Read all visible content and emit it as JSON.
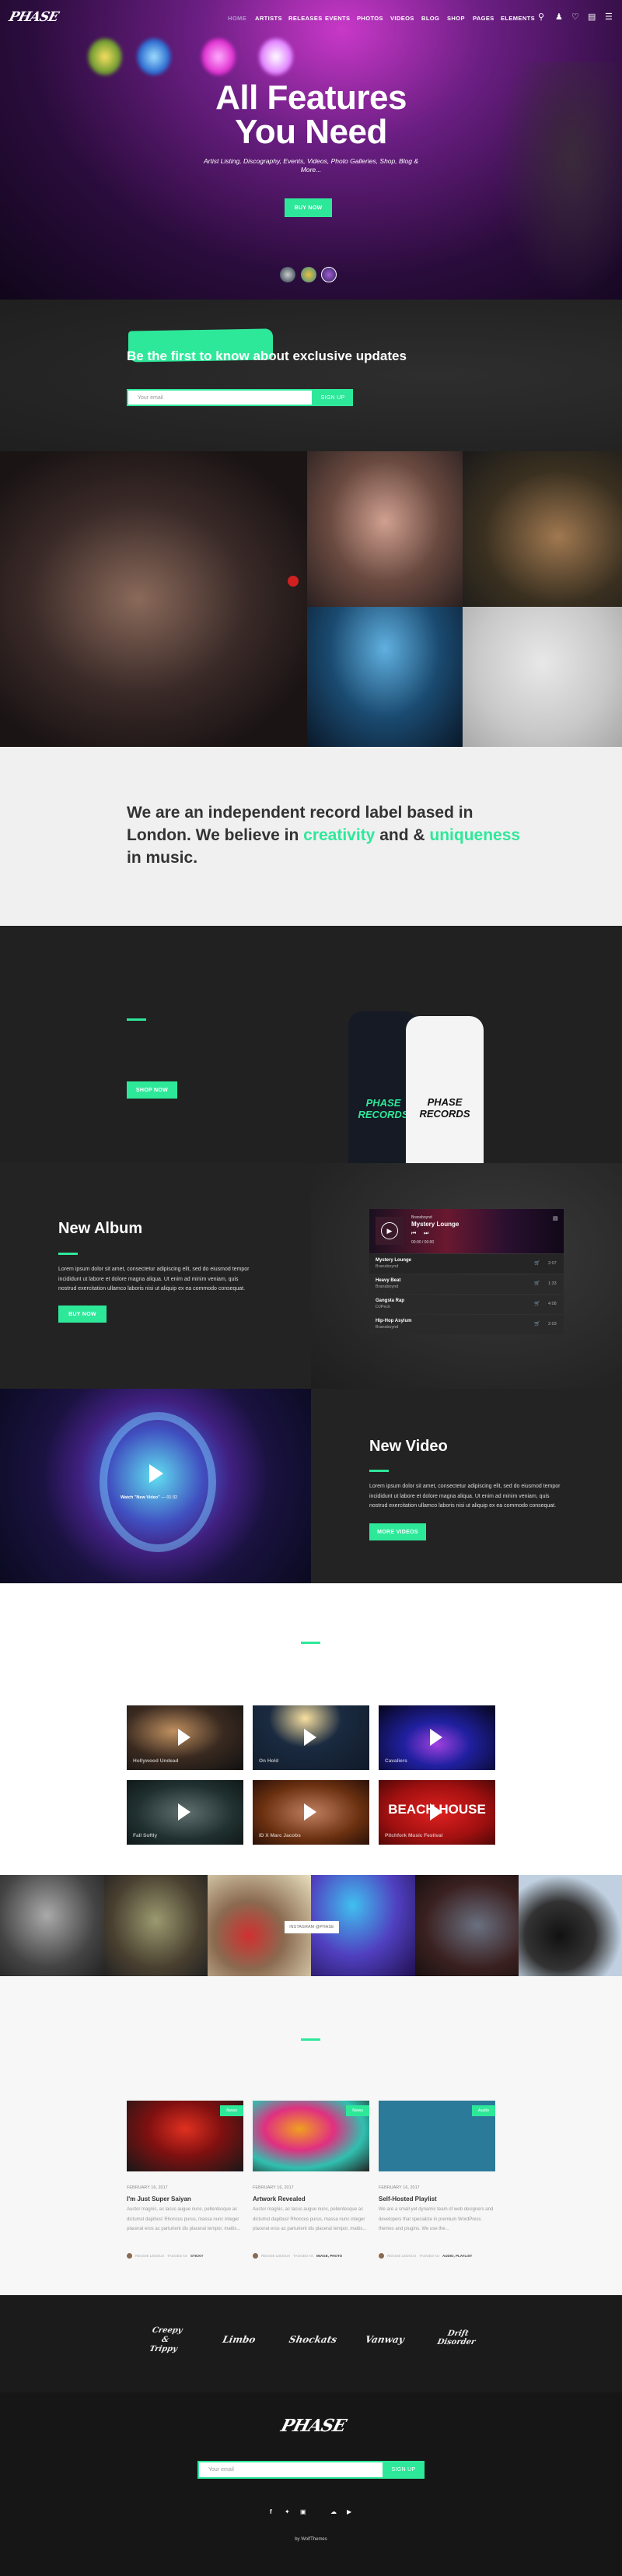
{
  "brand": {
    "logo": "PHASE",
    "accent": "#2ee89a"
  },
  "nav": {
    "items": [
      "HOME",
      "ARTISTS",
      "RELEASES",
      "EVENTS",
      "PHOTOS",
      "VIDEOS",
      "BLOG",
      "SHOP",
      "PAGES",
      "ELEMENTS"
    ],
    "active": "HOME",
    "icons": [
      "search-icon",
      "user-icon",
      "heart-icon",
      "cart-icon",
      "menu-icon"
    ]
  },
  "hero": {
    "title_line1": "All Features",
    "title_line2": "You Need",
    "subtitle": "Artist Listing, Discography, Events, Videos, Photo Galleries, Shop, Blog & More...",
    "button": "BUY NOW"
  },
  "newsletter": {
    "heading": "Be the first to know about exclusive updates",
    "placeholder": "Your email",
    "button": "SIGN UP"
  },
  "intro": {
    "part1": "We are an independent record label based in London. We believe in ",
    "highlight1": "creativity",
    "part2": " and & ",
    "highlight2": "uniqueness",
    "part3": " in music."
  },
  "merch": {
    "shirt_print": "PHASE RECORDS",
    "button": "SHOP NOW"
  },
  "album": {
    "title": "New Album",
    "text": "Lorem ipsum dolor sit amet, consectetur adipiscing elit, sed do eiusmod tempor incididunt ut labore et dolore magna aliqua. Ut enim ad minim veniam, quis nostrud exercitation ullamco laboris nisi ut aliquip ex ea commodo consequat.",
    "button": "BUY NOW",
    "player": {
      "artist": "Bransboynd",
      "track": "Mystery Lounge",
      "time": "00:00 / 00:00",
      "tracks": [
        {
          "title": "Mystery Lounge",
          "artist": "Bransboynd",
          "duration": "2:07"
        },
        {
          "title": "Heavy Beat",
          "artist": "Bransboynd",
          "duration": "1:33"
        },
        {
          "title": "Gangsta Rap",
          "artist": "DJPeck",
          "duration": "4:08"
        },
        {
          "title": "Hip-Hop Asylum",
          "artist": "Bransboynd",
          "duration": "2:03"
        }
      ]
    }
  },
  "video": {
    "title": "New Video",
    "caption": "Watch \"New Video\"",
    "duration": "— 01:32",
    "text": "Lorem ipsum dolor sit amet, consectetur adipiscing elit, sed do eiusmod tempor incididunt ut labore et dolore magna aliqua. Ut enim ad minim veniam, quis nostrud exercitation ullamco laboris nisi ut aliquip ex ea commodo consequat.",
    "button": "MORE VIDEOS"
  },
  "videos": [
    {
      "title": "Hollywood Undead"
    },
    {
      "title": "On Hold"
    },
    {
      "title": "Cavaliers"
    },
    {
      "title": "Fall Softly"
    },
    {
      "title": "ID X Marc Jacobs"
    },
    {
      "title": "Pitchfork Music Festival",
      "overlay": "BEACH HOUSE"
    }
  ],
  "instagram": {
    "label": "INSTAGRAM @PHASE"
  },
  "blog": [
    {
      "tag": "News",
      "date": "FEBRUARY 16, 2017",
      "title": "I'm Just Super Saiyan",
      "excerpt": "Auctor magnis, ac lacus augue nunc, pellentesque ac dictumst dapibus! Rhoncus purus, massa nunc integer placerat eros ac parturient dis placerat tempor, mattis...",
      "author": "REGGIE LEDOUX",
      "tagged_label": "TAGGED AS",
      "tags": "STICKY"
    },
    {
      "tag": "News",
      "date": "FEBRUARY 16, 2017",
      "title": "Artwork Revealed",
      "excerpt": "Auctor magnis, ac lacus augue nunc, pellentesque ac dictumst dapibus! Rhoncus purus, massa nunc integer placerat eros ac parturient dis placerat tempor, mattis...",
      "author": "REGGIE LEDOUX",
      "tagged_label": "TAGGED AS",
      "tags": "IMAGE, PHOTO"
    },
    {
      "tag": "Audio",
      "date": "FEBRUARY 16, 2017",
      "title": "Self-Hosted Playlist",
      "excerpt": "We are a small yet dynamic team of web designers and developers that specialize in premium WordPress themes and plugins. We use the...",
      "author": "REGGIE LEDOUX",
      "tagged_label": "TAGGED AS",
      "tags": "AUDIO, PLAYLIST"
    }
  ],
  "partner_logos": [
    "Creepy & Trippy",
    "Limbo",
    "Shockats",
    "Vanway",
    "Drift Disorder"
  ],
  "footer": {
    "logo": "PHASE",
    "placeholder": "Your email",
    "button": "SIGN UP",
    "socials": [
      "facebook-icon",
      "twitter-icon",
      "instagram-icon",
      "soundcloud-icon",
      "youtube-icon"
    ],
    "credit": "by WolfThemes"
  }
}
